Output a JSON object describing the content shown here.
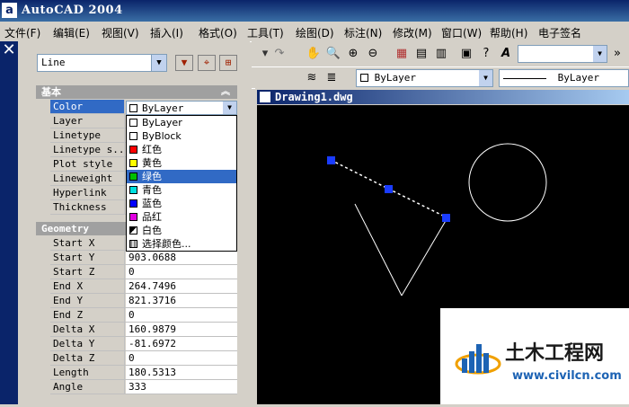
{
  "window": {
    "title": "AutoCAD 2004",
    "icon_letter": "a"
  },
  "menu": [
    "文件(F)",
    "编辑(E)",
    "视图(V)",
    "插入(I)",
    "格式(O)",
    "工具(T)",
    "绘图(D)",
    "标注(N)",
    "修改(M)",
    "窗口(W)",
    "帮助(H)",
    "电子签名"
  ],
  "properties": {
    "object_type": "Line",
    "category_basic": "基本",
    "category_geometry": "Geometry",
    "basic_rows": [
      {
        "name": "Color",
        "value": "ByLayer"
      },
      {
        "name": "Layer",
        "value": ""
      },
      {
        "name": "Linetype",
        "value": ""
      },
      {
        "name": "Linetype s...",
        "value": ""
      },
      {
        "name": "Plot style",
        "value": ""
      },
      {
        "name": "Lineweight",
        "value": ""
      },
      {
        "name": "Hyperlink",
        "value": ""
      },
      {
        "name": "Thickness",
        "value": ""
      }
    ],
    "geometry_rows": [
      {
        "name": "Start X",
        "value": ""
      },
      {
        "name": "Start Y",
        "value": "903.0688"
      },
      {
        "name": "Start Z",
        "value": "0"
      },
      {
        "name": "End X",
        "value": "264.7496"
      },
      {
        "name": "End Y",
        "value": "821.3716"
      },
      {
        "name": "End Z",
        "value": "0"
      },
      {
        "name": "Delta X",
        "value": "160.9879"
      },
      {
        "name": "Delta Y",
        "value": "-81.6972"
      },
      {
        "name": "Delta Z",
        "value": "0"
      },
      {
        "name": "Length",
        "value": "180.5313"
      },
      {
        "name": "Angle",
        "value": "333"
      }
    ]
  },
  "color_dropdown": {
    "selected": "ByLayer",
    "options": [
      {
        "label": "ByLayer",
        "color": "#ffffff"
      },
      {
        "label": "ByBlock",
        "color": "#ffffff"
      },
      {
        "label": "红色",
        "color": "#ff0000"
      },
      {
        "label": "黄色",
        "color": "#ffff00"
      },
      {
        "label": "绿色",
        "color": "#00c000"
      },
      {
        "label": "青色",
        "color": "#00e0e0"
      },
      {
        "label": "蓝色",
        "color": "#0000ff"
      },
      {
        "label": "品红",
        "color": "#e000e0"
      },
      {
        "label": "白色",
        "color": "diagonal"
      },
      {
        "label": "选择颜色...",
        "color": "grid"
      }
    ],
    "highlighted_index": 4
  },
  "layers_toolbar": {
    "layer_color_value": "ByLayer",
    "linetype_value": "ByLayer"
  },
  "document": {
    "title": "Drawing1.dwg"
  },
  "watermark": {
    "title": "土木工程网",
    "url": "www.civilcn.com"
  },
  "colors": {
    "titlebar": "#0a246a",
    "highlight": "#316ac5",
    "canvas": "#000000",
    "grip": "#1a3cff"
  }
}
